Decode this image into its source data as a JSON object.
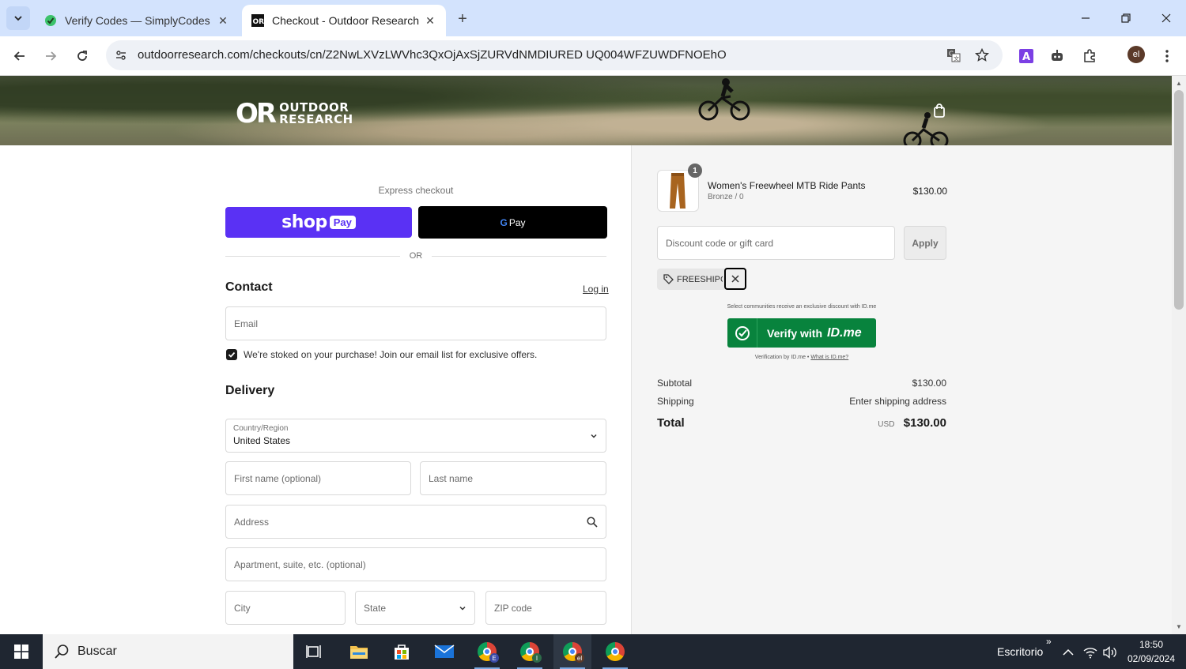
{
  "browser": {
    "tabs": [
      {
        "title": "Verify Codes — SimplyCodes",
        "active": false
      },
      {
        "title": "Checkout - Outdoor Research",
        "active": true
      }
    ],
    "url": "outdoorresearch.com/checkouts/cn/Z2NwLXVzLWVhc3QxOjAxSjZURVdNMDIURED UQ004WFZUWDFNOEhO",
    "profile_initial": "el"
  },
  "header": {
    "logo_mark": "OR",
    "logo_line1": "OUTDOOR",
    "logo_line2": "RESEARCH"
  },
  "express": {
    "label": "Express checkout",
    "shop_text": "shop",
    "shop_pay_badge": "Pay",
    "gpay_g": "G",
    "gpay_text": "Pay",
    "or_text": "OR"
  },
  "contact": {
    "title": "Contact",
    "login": "Log in",
    "email_placeholder": "Email",
    "newsletter_text": "We're stoked on your purchase! Join our email list for exclusive offers.",
    "newsletter_checked": true
  },
  "delivery": {
    "title": "Delivery",
    "country_label": "Country/Region",
    "country_value": "United States",
    "first_name_placeholder": "First name (optional)",
    "last_name_placeholder": "Last name",
    "address_placeholder": "Address",
    "apartment_placeholder": "Apartment, suite, etc. (optional)",
    "city_placeholder": "City",
    "state_placeholder": "State",
    "zip_placeholder": "ZIP code"
  },
  "order": {
    "item": {
      "quantity": "1",
      "name": "Women's Freewheel MTB Ride Pants",
      "variant": "Bronze / 0",
      "price": "$130.00"
    },
    "discount_placeholder": "Discount code or gift card",
    "apply_label": "Apply",
    "applied_code": "FREESHIPCS",
    "idme_note": "Select communities receive an exclusive discount with ID.me",
    "idme_button_text": "Verify with",
    "idme_brand": "ID.me",
    "idme_footer": "Verification by ID.me •",
    "idme_footer_link": "What is ID.me?",
    "subtotal_label": "Subtotal",
    "subtotal_value": "$130.00",
    "shipping_label": "Shipping",
    "shipping_value": "Enter shipping address",
    "total_label": "Total",
    "total_currency": "USD",
    "total_value": "$130.00"
  },
  "taskbar": {
    "search_text": "Buscar",
    "desktop_label": "Escritorio",
    "time": "18:50",
    "date": "02/09/2024",
    "chrome_badges": [
      "E",
      "I",
      "el",
      ""
    ]
  },
  "colors": {
    "shop_pay": "#5a31f4",
    "idme_green": "#08833d",
    "tab_bar": "#d3e3fd"
  }
}
